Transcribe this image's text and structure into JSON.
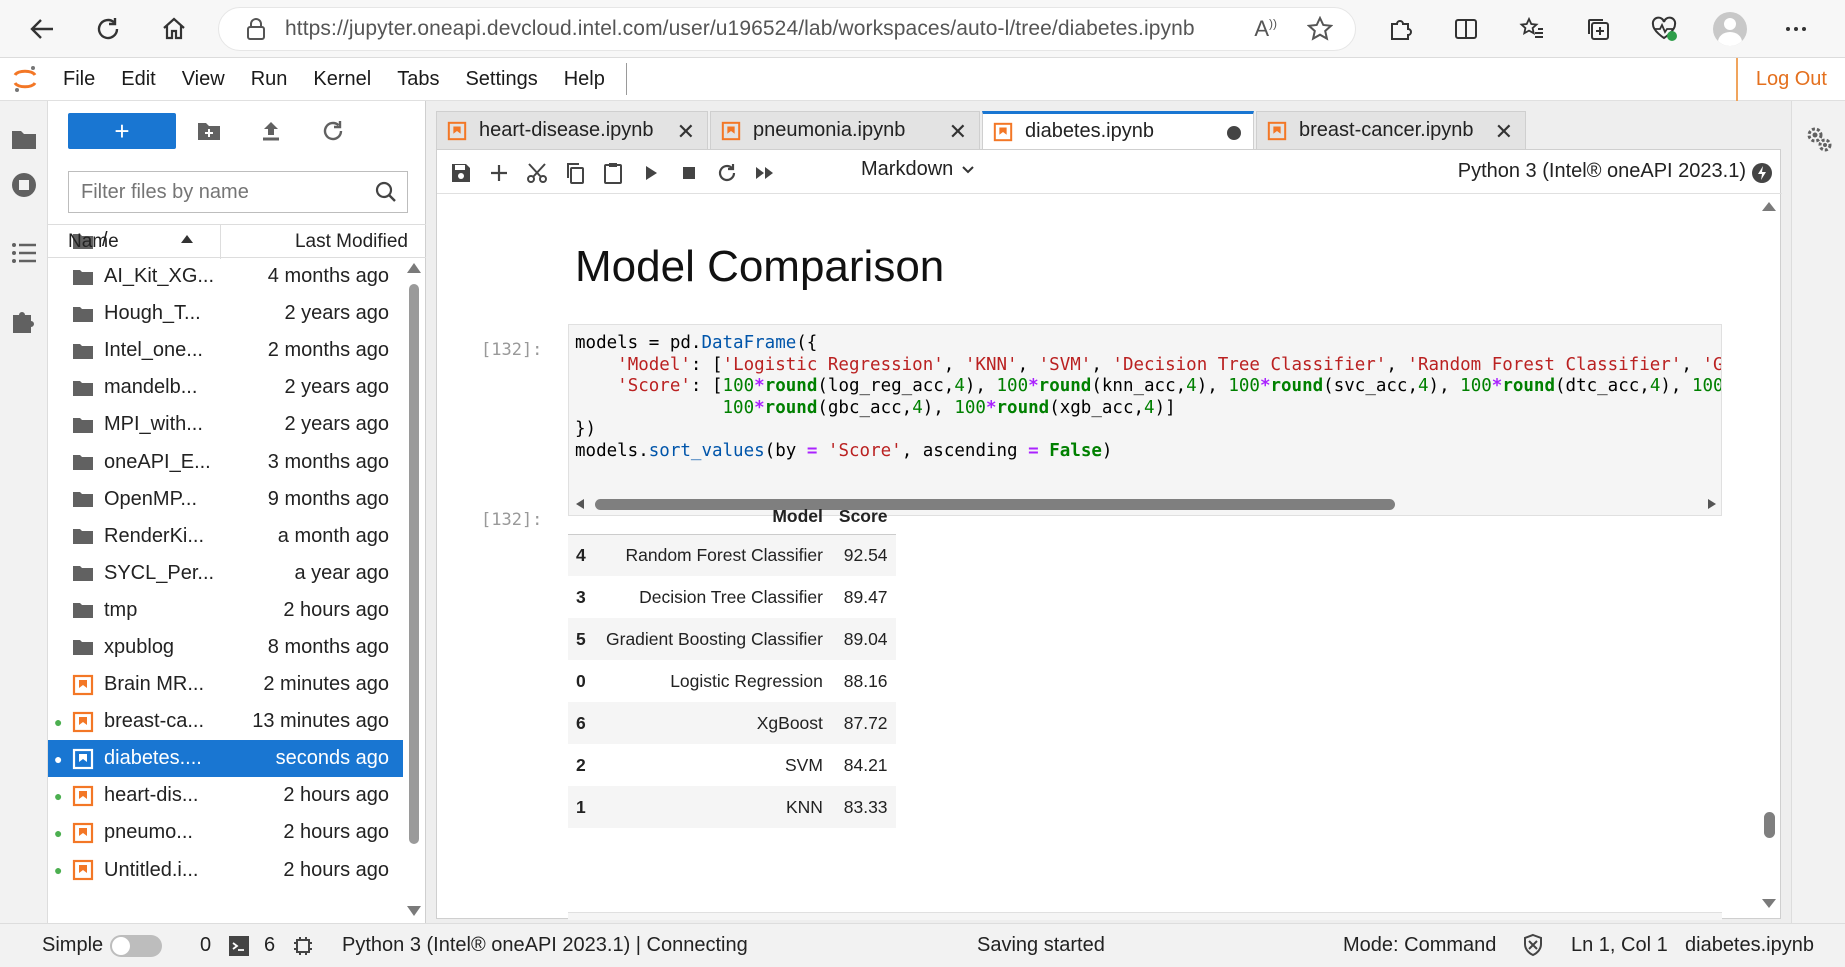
{
  "browser": {
    "url": "https://jupyter.oneapi.devcloud.intel.com/user/u196524/lab/workspaces/auto-l/tree/diabetes.ipynb"
  },
  "menu": {
    "items": [
      "File",
      "Edit",
      "View",
      "Run",
      "Kernel",
      "Tabs",
      "Settings",
      "Help"
    ],
    "logout": "Log Out"
  },
  "filebrowser": {
    "new_label": "+",
    "filter_placeholder": "Filter files by name",
    "breadcrumb": "/",
    "col_name": "Name",
    "col_modified": "Last Modified",
    "files": [
      {
        "name": "AI_Kit_XG...",
        "modified": "4 months ago",
        "type": "folder",
        "running": false,
        "selected": false
      },
      {
        "name": "Hough_T...",
        "modified": "2 years ago",
        "type": "folder",
        "running": false,
        "selected": false
      },
      {
        "name": "Intel_one...",
        "modified": "2 months ago",
        "type": "folder",
        "running": false,
        "selected": false
      },
      {
        "name": "mandelb...",
        "modified": "2 years ago",
        "type": "folder",
        "running": false,
        "selected": false
      },
      {
        "name": "MPI_with...",
        "modified": "2 years ago",
        "type": "folder",
        "running": false,
        "selected": false
      },
      {
        "name": "oneAPI_E...",
        "modified": "3 months ago",
        "type": "folder",
        "running": false,
        "selected": false
      },
      {
        "name": "OpenMP...",
        "modified": "9 months ago",
        "type": "folder",
        "running": false,
        "selected": false
      },
      {
        "name": "RenderKi...",
        "modified": "a month ago",
        "type": "folder",
        "running": false,
        "selected": false
      },
      {
        "name": "SYCL_Per...",
        "modified": "a year ago",
        "type": "folder",
        "running": false,
        "selected": false
      },
      {
        "name": "tmp",
        "modified": "2 hours ago",
        "type": "folder",
        "running": false,
        "selected": false
      },
      {
        "name": "xpublog",
        "modified": "8 months ago",
        "type": "folder",
        "running": false,
        "selected": false
      },
      {
        "name": "Brain MR...",
        "modified": "2 minutes ago",
        "type": "notebook",
        "running": false,
        "selected": false
      },
      {
        "name": "breast-ca...",
        "modified": "13 minutes ago",
        "type": "notebook",
        "running": true,
        "selected": false
      },
      {
        "name": "diabetes....",
        "modified": "seconds ago",
        "type": "notebook",
        "running": true,
        "selected": true
      },
      {
        "name": "heart-dis...",
        "modified": "2 hours ago",
        "type": "notebook",
        "running": true,
        "selected": false
      },
      {
        "name": "pneumo...",
        "modified": "2 hours ago",
        "type": "notebook",
        "running": true,
        "selected": false
      },
      {
        "name": "Untitled.i...",
        "modified": "2 hours ago",
        "type": "notebook",
        "running": true,
        "selected": false
      }
    ]
  },
  "tabs": [
    {
      "label": "heart-disease.ipynb",
      "active": false,
      "dirty": false
    },
    {
      "label": "pneumonia.ipynb",
      "active": false,
      "dirty": false
    },
    {
      "label": "diabetes.ipynb",
      "active": true,
      "dirty": true
    },
    {
      "label": "breast-cancer.ipynb",
      "active": false,
      "dirty": false
    }
  ],
  "notebook": {
    "cell_type": "Markdown",
    "kernel": "Python 3 (Intel® oneAPI 2023.1)",
    "heading": "Model Comparison",
    "in_prompt": "[132]:",
    "out_prompt": "[132]:",
    "output_table": {
      "columns": [
        "",
        "Model",
        "Score"
      ],
      "rows": [
        {
          "index": "4",
          "model": "Random Forest Classifier",
          "score": "92.54"
        },
        {
          "index": "3",
          "model": "Decision Tree Classifier",
          "score": "89.47"
        },
        {
          "index": "5",
          "model": "Gradient Boosting Classifier",
          "score": "89.04"
        },
        {
          "index": "0",
          "model": "Logistic Regression",
          "score": "88.16"
        },
        {
          "index": "6",
          "model": "XgBoost",
          "score": "87.72"
        },
        {
          "index": "2",
          "model": "SVM",
          "score": "84.21"
        },
        {
          "index": "1",
          "model": "KNN",
          "score": "83.33"
        }
      ]
    }
  },
  "statusbar": {
    "mode_label": "Simple",
    "terminals": "0",
    "kernels": "6",
    "kernel_status": "Python 3 (Intel® oneAPI 2023.1) | Connecting",
    "saving": "Saving started",
    "mode": "Mode: Command",
    "position": "Ln 1, Col 1",
    "file": "diabetes.ipynb"
  }
}
